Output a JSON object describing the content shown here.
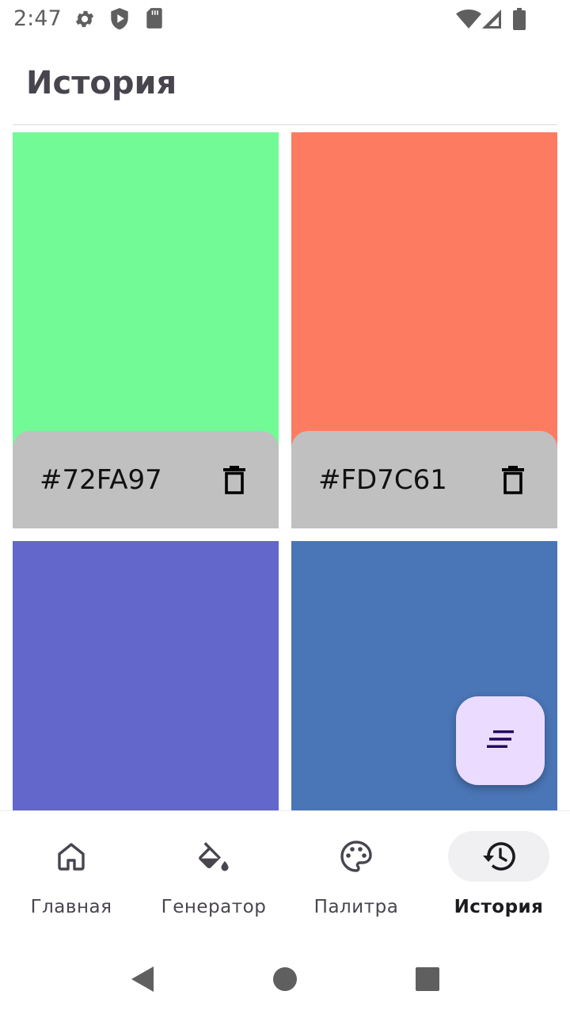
{
  "status_bar": {
    "time": "2:47",
    "left_icons": [
      "gear-icon",
      "shield-play-icon",
      "sd-card-icon"
    ],
    "right_icons": [
      "wifi-icon",
      "cell-signal-icon",
      "battery-icon"
    ]
  },
  "app_bar": {
    "title": "История"
  },
  "history": {
    "items": [
      {
        "hex": "#72FA97",
        "color": "#72FA97"
      },
      {
        "hex": "#FD7C61",
        "color": "#FD7C61"
      },
      {
        "hex": "",
        "color": "#6366CA"
      },
      {
        "hex": "",
        "color": "#4A75B6"
      }
    ]
  },
  "fab": {
    "icon": "sort-lines-icon",
    "color": "#EBDCFF"
  },
  "bottom_nav": {
    "items": [
      {
        "label": "Главная",
        "icon": "home-icon",
        "active": false
      },
      {
        "label": "Генератор",
        "icon": "paint-bucket-icon",
        "active": false
      },
      {
        "label": "Палитра",
        "icon": "palette-icon",
        "active": false
      },
      {
        "label": "История",
        "icon": "history-icon",
        "active": true
      }
    ]
  },
  "system_nav": {
    "icons": [
      "back-triangle-icon",
      "home-circle-icon",
      "recents-square-icon"
    ]
  }
}
